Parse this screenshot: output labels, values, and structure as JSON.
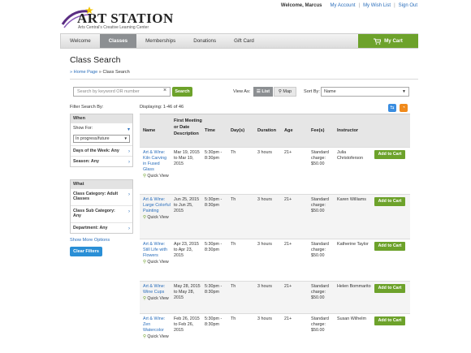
{
  "logo": {
    "title": "ART STATION",
    "subtitle": "Arts Central's Creative Learning Center"
  },
  "topnav": {
    "welcome": "Welcome, Marcus",
    "links": [
      "My Account",
      "My Wish List",
      "Sign Out"
    ]
  },
  "nav": {
    "tabs": [
      "Welcome",
      "Classes",
      "Memberships",
      "Donations",
      "Gift Card"
    ],
    "active": "Classes",
    "cart": "My Cart"
  },
  "page": {
    "title": "Class Search",
    "breadcrumb_home": "» Home Page",
    "breadcrumb_current": "» Class Search"
  },
  "search": {
    "placeholder": "Search by keyword OR number",
    "button": "Search"
  },
  "view": {
    "label": "View As:",
    "list": "List",
    "map": "Map"
  },
  "sort": {
    "label": "Sort By:",
    "value": "Name"
  },
  "filters": {
    "label": "Filter Search By:",
    "when_head": "When",
    "show_for": "Show For:",
    "status_value": "In progress/future",
    "days": "Days of the Week: Any",
    "season": "Season: Any",
    "what_head": "What",
    "category": "Class Category: Adult Classes",
    "subcategory": "Class Sub Category: Any",
    "department": "Department: Any",
    "show_more": "Show More Options",
    "clear": "Clear Filters"
  },
  "results": {
    "displaying": "Displaying: 1-46 of 46",
    "headers": {
      "name": "Name",
      "first": "First Meeting or Date Description",
      "time": "Time",
      "days": "Day(s)",
      "duration": "Duration",
      "age": "Age",
      "fees": "Fee(s)",
      "instructor": "Instructor"
    },
    "quick_view": "Quick View",
    "add_label": "Add to Cart",
    "rows": [
      {
        "name": "Art & Wine: Kiln Carving in Fused Glass",
        "dates": "Mar 19, 2015 to Mar 19, 2015",
        "time": "5:30pm - 8:30pm",
        "days": "Th",
        "duration": "3 hours",
        "age": "21+",
        "fee": "Standard charge: $50.00",
        "instructor": "Julia Christoferson"
      },
      {
        "name": "Art & Wine: Large Colorful Painting",
        "dates": "Jun 25, 2015 to Jun 25, 2015",
        "time": "5:30pm - 8:30pm",
        "days": "Th",
        "duration": "3 hours",
        "age": "21+",
        "fee": "Standard charge: $50.00",
        "instructor": "Karen Williams"
      },
      {
        "name": "Art & Wine: Still Life with Flowers",
        "dates": "Apr 23, 2015 to Apr 23, 2015",
        "time": "5:30pm - 8:30pm",
        "days": "Th",
        "duration": "3 hours",
        "age": "21+",
        "fee": "Standard charge: $50.00",
        "instructor": "Katherine Taylor"
      },
      {
        "name": "Art & Wine: Wine Cups",
        "dates": "May 28, 2015 to May 28, 2015",
        "time": "5:30pm - 8:30pm",
        "days": "Th",
        "duration": "3 hours",
        "age": "21+",
        "fee": "Standard charge: $50.00",
        "instructor": "Helen Bommarito"
      },
      {
        "name": "Art & Wine: Zen Watercolor",
        "dates": "Feb 26, 2015 to Feb 26, 2015",
        "time": "5:30pm - 8:30pm",
        "days": "Th",
        "duration": "3 hours",
        "age": "21+",
        "fee": "Standard charge: $50.00",
        "instructor": "Susan Wilhelm"
      }
    ]
  },
  "colors": {
    "accent_green": "#6da22b",
    "link_blue": "#2a6ebb",
    "active_tab": "#8c8f92"
  }
}
